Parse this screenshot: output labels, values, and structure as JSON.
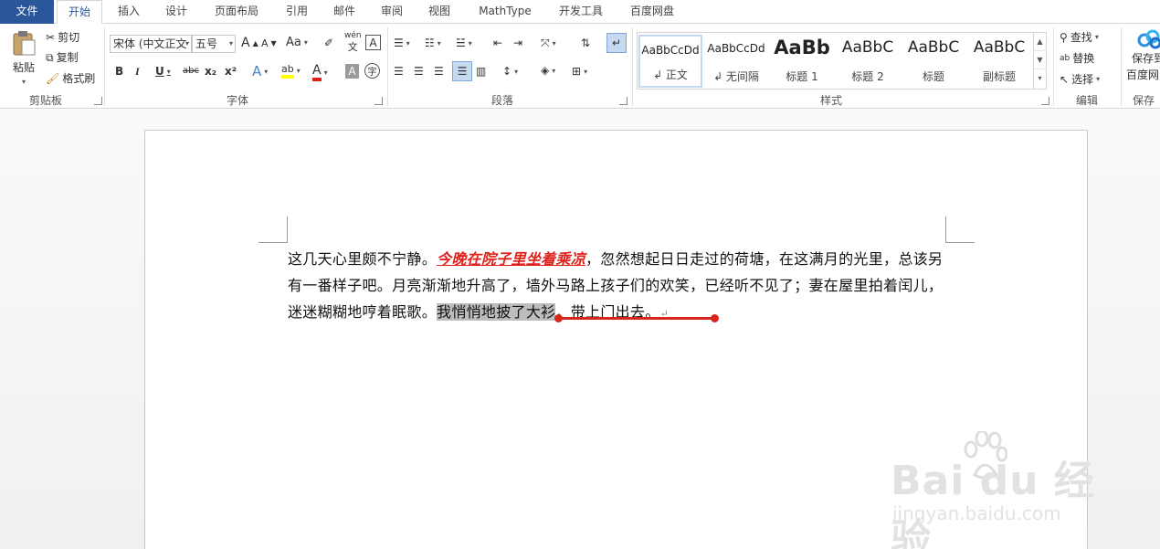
{
  "tabs": [
    {
      "label": "文件",
      "name": "tab-file"
    },
    {
      "label": "开始",
      "name": "tab-home"
    },
    {
      "label": "插入",
      "name": "tab-insert"
    },
    {
      "label": "设计",
      "name": "tab-design"
    },
    {
      "label": "页面布局",
      "name": "tab-page-layout"
    },
    {
      "label": "引用",
      "name": "tab-references"
    },
    {
      "label": "邮件",
      "name": "tab-mailings"
    },
    {
      "label": "审阅",
      "name": "tab-review"
    },
    {
      "label": "视图",
      "name": "tab-view"
    },
    {
      "label": "MathType",
      "name": "tab-mathtype"
    },
    {
      "label": "开发工具",
      "name": "tab-developer"
    },
    {
      "label": "百度网盘",
      "name": "tab-baidu-netdisk"
    }
  ],
  "clipboard": {
    "paste": "粘贴",
    "cut": "剪切",
    "copy": "复制",
    "format_painter": "格式刷",
    "group": "剪贴板"
  },
  "font": {
    "family": "宋体 (中文正文",
    "size": "五号",
    "grow": "A",
    "shrink": "A",
    "change_case": "Aa",
    "phonetic": "wén",
    "border_char": "A",
    "bold": "B",
    "italic": "I",
    "underline": "U",
    "strikethrough": "abc",
    "subscript": "x₂",
    "superscript": "x²",
    "text_effects": "A",
    "highlight": "ab",
    "font_color": "A",
    "shading": "A",
    "enclose": "字",
    "group": "字体"
  },
  "paragraph": {
    "group": "段落"
  },
  "styles": {
    "items": [
      {
        "sample": "AaBbCcDd",
        "name": "↲ 正文"
      },
      {
        "sample": "AaBbCcDd",
        "name": "↲ 无间隔"
      },
      {
        "sample": "AaBb",
        "name": "标题 1"
      },
      {
        "sample": "AaBbC",
        "name": "标题 2"
      },
      {
        "sample": "AaBbC",
        "name": "标题"
      },
      {
        "sample": "AaBbC",
        "name": "副标题"
      }
    ],
    "group": "样式"
  },
  "editing": {
    "find": "查找",
    "replace": "替换",
    "select": "选择",
    "group": "编辑"
  },
  "save": {
    "label1": "保存到",
    "label2": "百度网",
    "group": "保存"
  },
  "document": {
    "seg1": "这几天心里颇不宁静。",
    "seg2": "今晚在院子里坐着乘凉",
    "seg3": "，忽然想起日日走过的荷塘，在这满月的光里，总该另有一番样子吧。月亮渐渐地升高了，墙外马路上孩子们的欢笑，已经听不见了；妻在屋里拍着闰儿，迷迷糊糊地哼着眠歌。",
    "seg4": "我悄悄地披了大衫",
    "seg5": "，带上门出去。",
    "para_mark": "↵"
  },
  "watermark": {
    "brand": "Bai du 经验",
    "url": "jingyan.baidu.com"
  },
  "colors": {
    "file_tab": "#2b579a",
    "emphasis": "#e0201b",
    "selection": "#bdbdbd",
    "annotation": "#d9261c"
  }
}
